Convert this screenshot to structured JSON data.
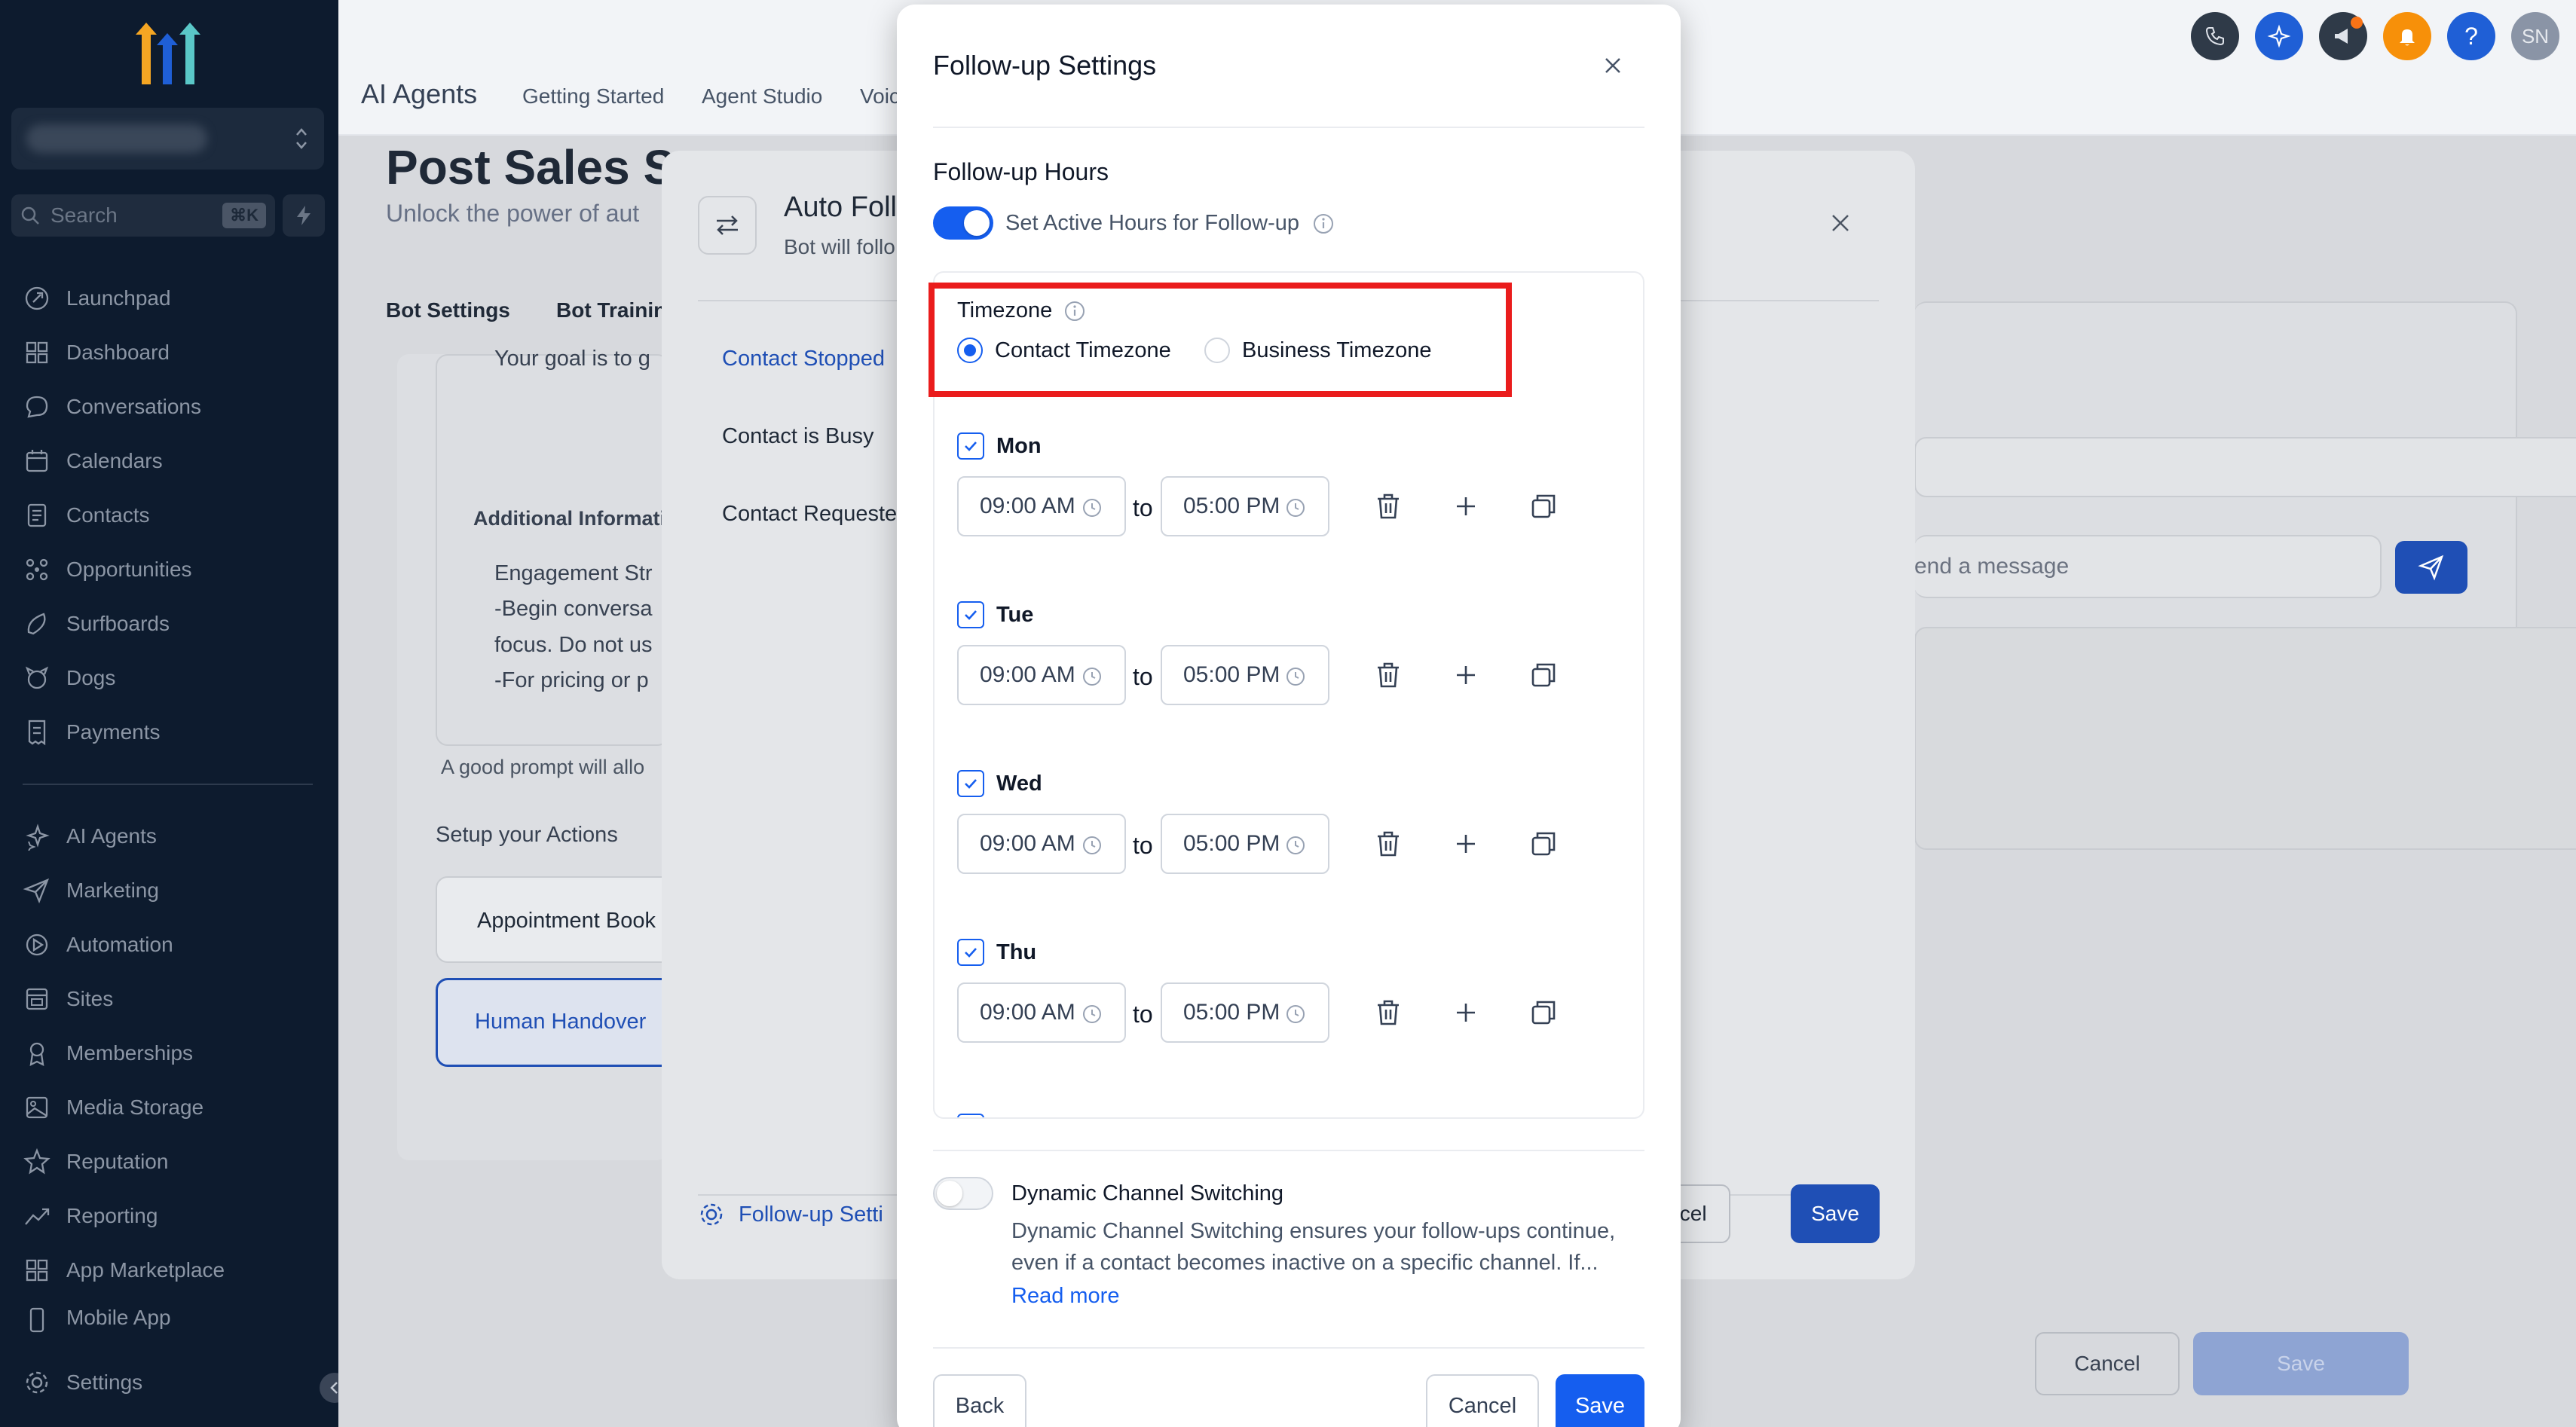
{
  "sidebar": {
    "search_label": "Search",
    "search_shortcut": "⌘K",
    "items_primary": [
      {
        "label": "Launchpad",
        "icon": "rocket-icon"
      },
      {
        "label": "Dashboard",
        "icon": "grid-icon"
      },
      {
        "label": "Conversations",
        "icon": "chat-icon"
      },
      {
        "label": "Calendars",
        "icon": "calendar-icon"
      },
      {
        "label": "Contacts",
        "icon": "contacts-icon"
      },
      {
        "label": "Opportunities",
        "icon": "funnel-icon"
      },
      {
        "label": "Surfboards",
        "icon": "surfboard-icon"
      },
      {
        "label": "Dogs",
        "icon": "dog-icon"
      },
      {
        "label": "Payments",
        "icon": "receipt-icon"
      }
    ],
    "items_secondary": [
      {
        "label": "AI Agents",
        "icon": "sparkle-icon"
      },
      {
        "label": "Marketing",
        "icon": "send-icon"
      },
      {
        "label": "Automation",
        "icon": "automation-icon"
      },
      {
        "label": "Sites",
        "icon": "sites-icon"
      },
      {
        "label": "Memberships",
        "icon": "membership-icon"
      },
      {
        "label": "Media Storage",
        "icon": "image-icon"
      },
      {
        "label": "Reputation",
        "icon": "star-icon"
      },
      {
        "label": "Reporting",
        "icon": "chart-icon"
      },
      {
        "label": "App Marketplace",
        "icon": "apps-icon"
      },
      {
        "label": "Mobile App",
        "icon": "mobile-icon"
      }
    ],
    "settings_label": "Settings"
  },
  "topbar": {
    "title": "AI Agents",
    "tabs": [
      "Getting Started",
      "Agent Studio",
      "Voic"
    ],
    "avatar_initials": "SN",
    "icon_colors": {
      "phone": "#2f3a48",
      "ai": "#1f5fd6",
      "announce": "#2f3a48",
      "bell": "#f79009",
      "help": "#1f5fd6",
      "avatar": "#8a94a6"
    }
  },
  "page": {
    "heading": "Post Sales Su",
    "subheading": "Unlock the power of aut",
    "tabs": [
      "Bot Settings",
      "Bot Trainin"
    ],
    "prompt_text": "Your goal is to g",
    "additional_label": "Additional Informati",
    "engagement_lines": [
      "Engagement Str",
      "-Begin conversa",
      "focus. Do not us",
      "-For pricing or p"
    ],
    "prompt_hint": "A good prompt will allo",
    "actions_label": "Setup your Actions",
    "action_appointment": "Appointment Book",
    "action_handover": "Human Handover",
    "message_placeholder": "end a message",
    "cancel_label": "Cancel",
    "save_label": "Save"
  },
  "auto_modal": {
    "title": "Auto Foll",
    "subtitle": "Bot will follo",
    "triggers": [
      "Contact Stopped",
      "Contact is Busy",
      "Contact Requeste"
    ],
    "settings_link": "Follow-up Setti",
    "cancel_label": "Cancel",
    "save_label": "Save"
  },
  "followup": {
    "title": "Follow-up Settings",
    "section_title": "Follow-up Hours",
    "active_hours_label": "Set Active Hours for Follow-up",
    "active_hours_enabled": true,
    "timezone_label": "Timezone",
    "timezone_options": [
      "Contact Timezone",
      "Business Timezone"
    ],
    "timezone_selected": "Contact Timezone",
    "to_label": "to",
    "days": [
      {
        "name": "Mon",
        "checked": true,
        "from": "09:00 AM",
        "to": "05:00 PM"
      },
      {
        "name": "Tue",
        "checked": true,
        "from": "09:00 AM",
        "to": "05:00 PM"
      },
      {
        "name": "Wed",
        "checked": true,
        "from": "09:00 AM",
        "to": "05:00 PM"
      },
      {
        "name": "Thu",
        "checked": true,
        "from": "09:00 AM",
        "to": "05:00 PM"
      }
    ],
    "dynamic_title": "Dynamic Channel Switching",
    "dynamic_enabled": false,
    "dynamic_desc": "Dynamic Channel Switching ensures your follow-ups continue, even if a contact becomes inactive on a specific channel. If...",
    "read_more": "Read more",
    "back_label": "Back",
    "cancel_label": "Cancel",
    "save_label": "Save",
    "accent_color": "#155eef",
    "highlight_color": "#ea1c1c"
  }
}
